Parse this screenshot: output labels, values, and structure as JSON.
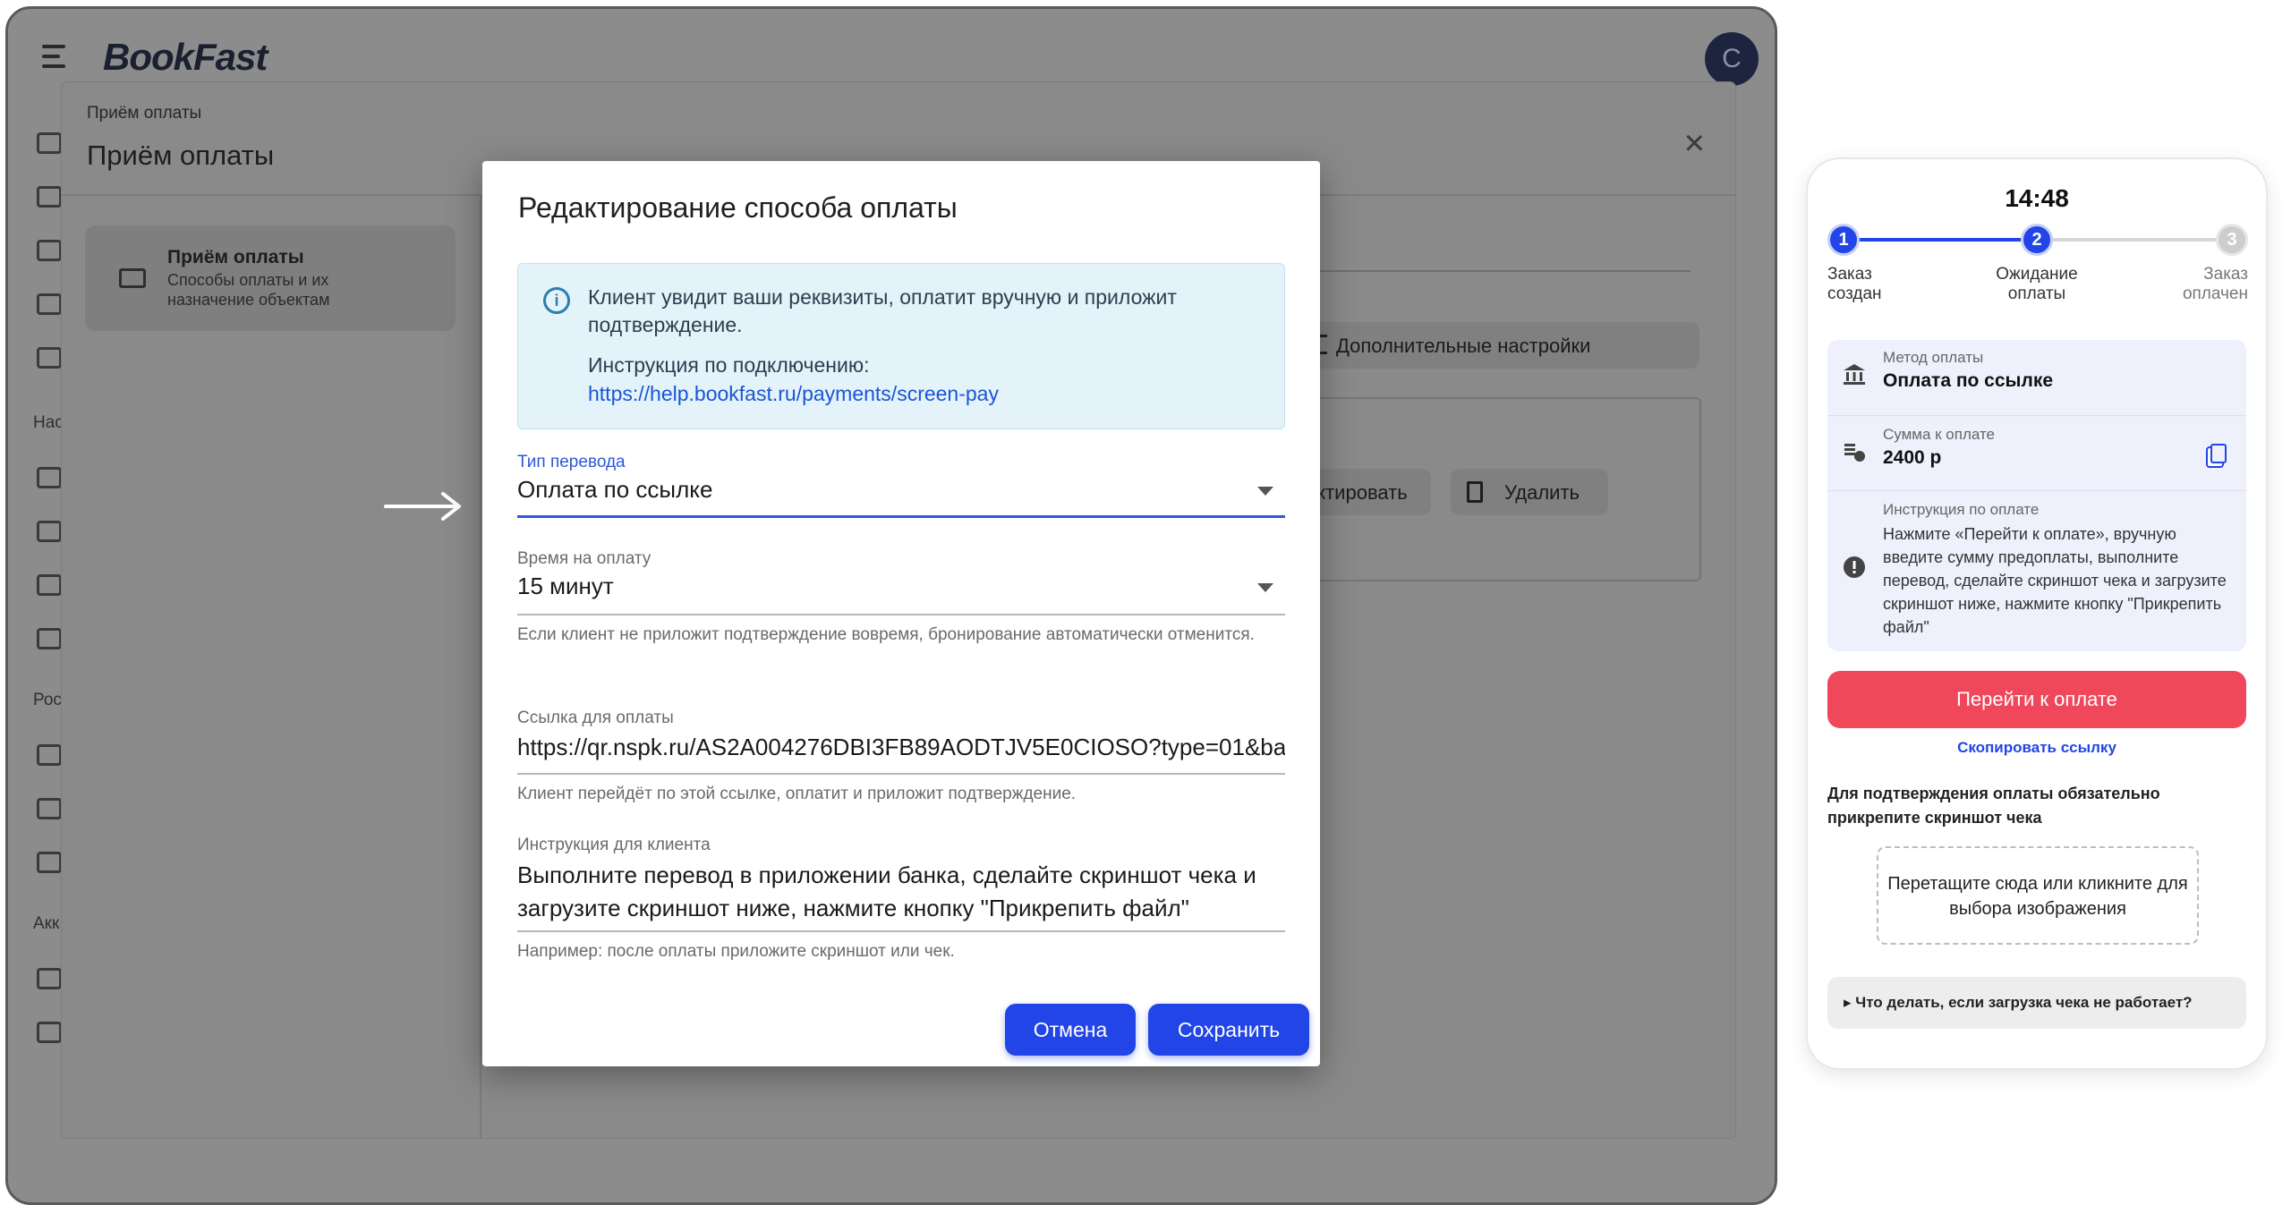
{
  "app": {
    "logo": "BookFast",
    "avatar_letter": "C",
    "rail_labels": [
      "Нас",
      "Рос",
      "Акк"
    ]
  },
  "background": {
    "breadcrumb": "Приём оплаты",
    "title": "Приём оплаты",
    "nav_card": {
      "title": "Приём оплаты",
      "subtitle": "Способы оплаты и их назначение объектам"
    },
    "more_settings_label": "Дополнительные настройки",
    "edit_label": "актировать",
    "delete_label": "Удалить"
  },
  "dialog": {
    "title": "Редактирование способа оплаты",
    "info": {
      "text": "Клиент увидит ваши реквизиты, оплатит вручную и приложит подтверждение.",
      "instruction_label": "Инструкция по подключению:",
      "link": "https://help.bookfast.ru/payments/screen-pay"
    },
    "transfer_type": {
      "label": "Тип перевода",
      "value": "Оплата по ссылке"
    },
    "payment_time": {
      "label": "Время на оплату",
      "value": "15 минут",
      "help": "Если клиент не приложит подтверждение вовремя, бронирование автоматически отменится."
    },
    "payment_link": {
      "label": "Ссылка для оплаты",
      "value": "https://qr.nspk.ru/AS2A004276DBI3FB89AODTJV5E0CIOSO?type=01&ba",
      "help": "Клиент перейдёт по этой ссылке, оплатит и приложит подтверждение."
    },
    "client_instruction": {
      "label": "Инструкция для клиента",
      "value": "Выполните перевод в приложении банка, сделайте скриншот чека и загрузите скриншот ниже, нажмите кнопку \"Прикрепить файл\"",
      "help": "Например: после оплаты приложите скриншот или чек."
    },
    "cancel_label": "Отмена",
    "save_label": "Сохранить"
  },
  "phone": {
    "clock": "14:48",
    "steps": [
      {
        "num": "1",
        "label": "Заказ создан",
        "state": "done"
      },
      {
        "num": "2",
        "label": "Ожидание оплаты",
        "state": "current"
      },
      {
        "num": "3",
        "label": "Заказ оплачен",
        "state": "todo"
      }
    ],
    "method_label": "Метод оплаты",
    "method_value": "Оплата по ссылке",
    "amount_label": "Сумма к оплате",
    "amount_value": "2400 р",
    "instruction_label": "Инструкция по оплате",
    "instruction_text": "Нажмите «Перейти к оплате», вручную введите сумму предоплаты, выполните перевод, сделайте скриншот чека и загрузите скриншот ниже, нажмите кнопку \"Прикрепить файл\"",
    "pay_button": "Перейти к оплате",
    "copy_link": "Скопировать ссылку",
    "confirm_note": "Для подтверждения оплаты обязательно прикрепите скриншот чека",
    "drop_zone": "Перетащите сюда или кликните для выбора изображения",
    "faq": "▸ Что делать, если загрузка чека не работает?"
  },
  "colors": {
    "accent": "#2145e6",
    "pay_button": "#f0475b",
    "info_bg": "#e4f3f9"
  },
  "icons": [
    "menu-icon",
    "close-icon",
    "info-icon",
    "dropdown-caret-icon",
    "bank-icon",
    "coins-icon",
    "copy-icon",
    "alert-icon",
    "arrow-right-icon"
  ]
}
